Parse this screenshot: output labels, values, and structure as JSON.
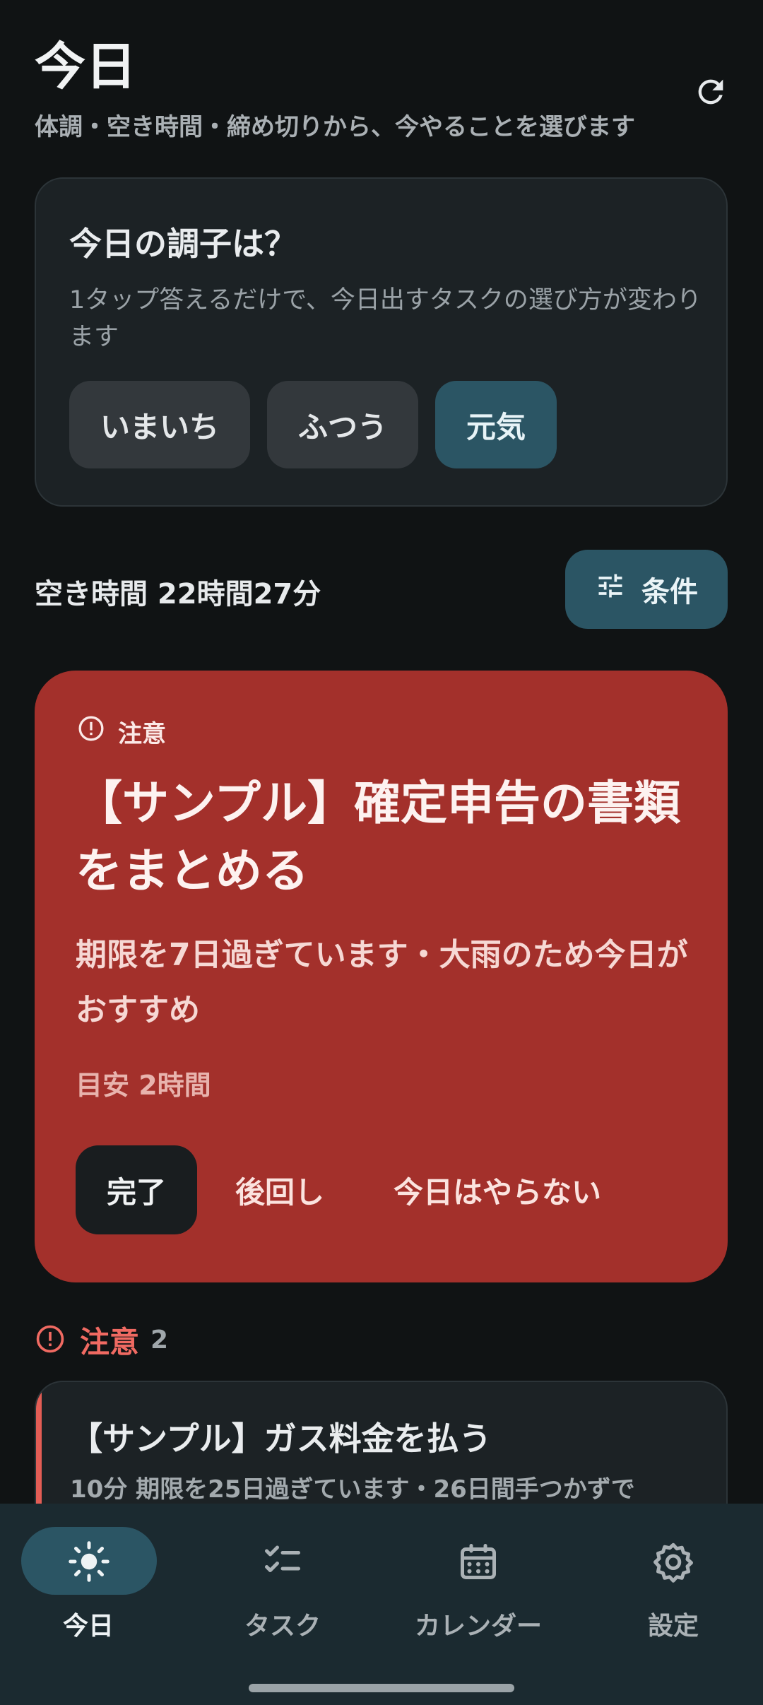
{
  "header": {
    "title": "今日",
    "subtitle": "体調・空き時間・締め切りから、今やることを選びます"
  },
  "mood": {
    "title": "今日の調子は？",
    "description": "1タップ答えるだけで、今日出すタスクの選び方が変わります",
    "options": [
      "いまいち",
      "ふつう",
      "元気"
    ],
    "selected": "元気"
  },
  "free_time": {
    "text": "空き時間 22時間27分"
  },
  "conditions_button": {
    "label": "条件"
  },
  "focus_task": {
    "label": "注意",
    "title": "【サンプル】確定申告の書類をまとめる",
    "reason": "期限を7日過ぎています・大雨のため今日がおすすめ",
    "estimate": "目安 2時間",
    "actions": {
      "done": "完了",
      "postpone": "後回し",
      "skip": "今日はやらない"
    }
  },
  "attention_section": {
    "title": "注意",
    "count": "2",
    "tasks": [
      {
        "title": "【サンプル】ガス料金を払う",
        "meta": "10分  期限を25日過ぎています・26日間手つかずで"
      }
    ]
  },
  "nav": {
    "items": [
      {
        "label": "今日",
        "icon": "sun-icon",
        "active": true
      },
      {
        "label": "タスク",
        "icon": "checklist-icon",
        "active": false
      },
      {
        "label": "カレンダー",
        "icon": "calendar-icon",
        "active": false
      },
      {
        "label": "設定",
        "icon": "gear-icon",
        "active": false
      }
    ]
  },
  "colors": {
    "background": "#101314",
    "card": "#1c2225",
    "accent": "#2b5564",
    "alert": "#a3302b",
    "alert_text": "#f06a62",
    "nav_bg": "#1b2a30"
  }
}
